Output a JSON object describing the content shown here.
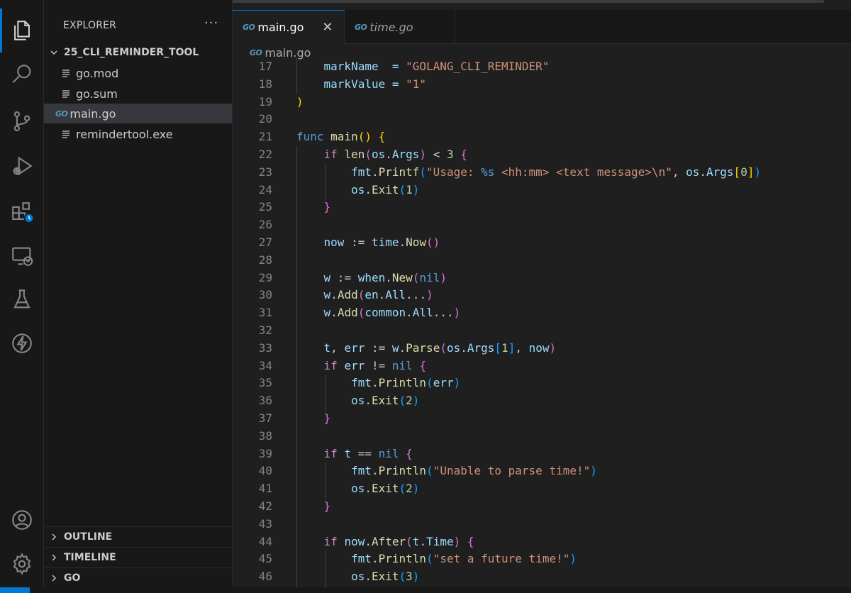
{
  "sidebar": {
    "title": "EXPLORER",
    "more": "···",
    "folder": "25_CLI_REMINDER_TOOL",
    "files": [
      {
        "label": "go.mod",
        "icon": "text-file-icon"
      },
      {
        "label": "go.sum",
        "icon": "text-file-icon"
      },
      {
        "label": "main.go",
        "icon": "go-file-icon",
        "badge": "GO",
        "selected": true
      },
      {
        "label": "remindertool.exe",
        "icon": "text-file-icon"
      }
    ],
    "sections": [
      "OUTLINE",
      "TIMELINE",
      "GO"
    ]
  },
  "tabs": [
    {
      "badge": "GO",
      "label": "main.go",
      "close": "✕"
    },
    {
      "badge": "GO",
      "label": "time.go"
    }
  ],
  "breadcrumb": {
    "badge": "GO",
    "label": "main.go"
  },
  "colors": {
    "accent": "#0078d4",
    "background": "#1f1f1f",
    "sidebar": "#181818",
    "go": "#519aba"
  },
  "code": [
    {
      "n": "17",
      "tokens": [
        [
          "    markName  = ",
          "t-var"
        ],
        [
          "\"GOLANG_CLI_REMINDER\"",
          "t-str"
        ]
      ]
    },
    {
      "n": "18",
      "tokens": [
        [
          "    markValue = ",
          "t-var"
        ],
        [
          "\"1\"",
          "t-str"
        ]
      ]
    },
    {
      "n": "19",
      "tokens": [
        [
          ")",
          "t-b1"
        ]
      ]
    },
    {
      "n": "20",
      "tokens": []
    },
    {
      "n": "21",
      "tokens": [
        [
          "func ",
          "t-kw"
        ],
        [
          "main",
          "t-fn"
        ],
        [
          "()",
          "t-b1"
        ],
        [
          " ",
          "t-plain"
        ],
        [
          "{",
          "t-b1"
        ]
      ]
    },
    {
      "n": "22",
      "tokens": [
        [
          "    ",
          "t-plain"
        ],
        [
          "if ",
          "t-ctl"
        ],
        [
          "len",
          "t-fn"
        ],
        [
          "(",
          "t-b2"
        ],
        [
          "os",
          "t-var"
        ],
        [
          ".",
          "t-plain"
        ],
        [
          "Args",
          "t-var"
        ],
        [
          ")",
          "t-b2"
        ],
        [
          " < ",
          "t-plain"
        ],
        [
          "3",
          "t-num"
        ],
        [
          " ",
          "t-plain"
        ],
        [
          "{",
          "t-b2"
        ]
      ]
    },
    {
      "n": "23",
      "tokens": [
        [
          "        ",
          "t-plain"
        ],
        [
          "fmt",
          "t-var"
        ],
        [
          ".",
          "t-plain"
        ],
        [
          "Printf",
          "t-fn"
        ],
        [
          "(",
          "t-b3"
        ],
        [
          "\"Usage: ",
          "t-str"
        ],
        [
          "%s",
          "t-kw"
        ],
        [
          " <hh:mm> <text message>",
          "t-str"
        ],
        [
          "\\n",
          "t-str"
        ],
        [
          "\"",
          "t-str"
        ],
        [
          ", ",
          "t-plain"
        ],
        [
          "os",
          "t-var"
        ],
        [
          ".",
          "t-plain"
        ],
        [
          "Args",
          "t-var"
        ],
        [
          "[",
          "t-b1"
        ],
        [
          "0",
          "t-num"
        ],
        [
          "]",
          "t-b1"
        ],
        [
          ")",
          "t-b3"
        ]
      ]
    },
    {
      "n": "24",
      "tokens": [
        [
          "        ",
          "t-plain"
        ],
        [
          "os",
          "t-var"
        ],
        [
          ".",
          "t-plain"
        ],
        [
          "Exit",
          "t-fn"
        ],
        [
          "(",
          "t-b3"
        ],
        [
          "1",
          "t-num"
        ],
        [
          ")",
          "t-b3"
        ]
      ]
    },
    {
      "n": "25",
      "tokens": [
        [
          "    ",
          "t-plain"
        ],
        [
          "}",
          "t-b2"
        ]
      ]
    },
    {
      "n": "26",
      "tokens": []
    },
    {
      "n": "27",
      "tokens": [
        [
          "    ",
          "t-plain"
        ],
        [
          "now",
          "t-var"
        ],
        [
          " := ",
          "t-plain"
        ],
        [
          "time",
          "t-var"
        ],
        [
          ".",
          "t-plain"
        ],
        [
          "Now",
          "t-fn"
        ],
        [
          "()",
          "t-b2"
        ]
      ]
    },
    {
      "n": "28",
      "tokens": []
    },
    {
      "n": "29",
      "tokens": [
        [
          "    ",
          "t-plain"
        ],
        [
          "w",
          "t-var"
        ],
        [
          " := ",
          "t-plain"
        ],
        [
          "when",
          "t-var"
        ],
        [
          ".",
          "t-plain"
        ],
        [
          "New",
          "t-fn"
        ],
        [
          "(",
          "t-b2"
        ],
        [
          "nil",
          "t-kw"
        ],
        [
          ")",
          "t-b2"
        ]
      ]
    },
    {
      "n": "30",
      "tokens": [
        [
          "    ",
          "t-plain"
        ],
        [
          "w",
          "t-var"
        ],
        [
          ".",
          "t-plain"
        ],
        [
          "Add",
          "t-fn"
        ],
        [
          "(",
          "t-b2"
        ],
        [
          "en",
          "t-var"
        ],
        [
          ".",
          "t-plain"
        ],
        [
          "All",
          "t-var"
        ],
        [
          "...",
          "t-plain"
        ],
        [
          ")",
          "t-b2"
        ]
      ]
    },
    {
      "n": "31",
      "tokens": [
        [
          "    ",
          "t-plain"
        ],
        [
          "w",
          "t-var"
        ],
        [
          ".",
          "t-plain"
        ],
        [
          "Add",
          "t-fn"
        ],
        [
          "(",
          "t-b2"
        ],
        [
          "common",
          "t-var"
        ],
        [
          ".",
          "t-plain"
        ],
        [
          "All",
          "t-var"
        ],
        [
          "...",
          "t-plain"
        ],
        [
          ")",
          "t-b2"
        ]
      ]
    },
    {
      "n": "32",
      "tokens": []
    },
    {
      "n": "33",
      "tokens": [
        [
          "    ",
          "t-plain"
        ],
        [
          "t",
          "t-var"
        ],
        [
          ", ",
          "t-plain"
        ],
        [
          "err",
          "t-var"
        ],
        [
          " := ",
          "t-plain"
        ],
        [
          "w",
          "t-var"
        ],
        [
          ".",
          "t-plain"
        ],
        [
          "Parse",
          "t-fn"
        ],
        [
          "(",
          "t-b2"
        ],
        [
          "os",
          "t-var"
        ],
        [
          ".",
          "t-plain"
        ],
        [
          "Args",
          "t-var"
        ],
        [
          "[",
          "t-b3"
        ],
        [
          "1",
          "t-num"
        ],
        [
          "]",
          "t-b3"
        ],
        [
          ", ",
          "t-plain"
        ],
        [
          "now",
          "t-var"
        ],
        [
          ")",
          "t-b2"
        ]
      ]
    },
    {
      "n": "34",
      "tokens": [
        [
          "    ",
          "t-plain"
        ],
        [
          "if ",
          "t-ctl"
        ],
        [
          "err",
          "t-var"
        ],
        [
          " != ",
          "t-plain"
        ],
        [
          "nil",
          "t-kw"
        ],
        [
          " ",
          "t-plain"
        ],
        [
          "{",
          "t-b2"
        ]
      ]
    },
    {
      "n": "35",
      "tokens": [
        [
          "        ",
          "t-plain"
        ],
        [
          "fmt",
          "t-var"
        ],
        [
          ".",
          "t-plain"
        ],
        [
          "Println",
          "t-fn"
        ],
        [
          "(",
          "t-b3"
        ],
        [
          "err",
          "t-var"
        ],
        [
          ")",
          "t-b3"
        ]
      ]
    },
    {
      "n": "36",
      "tokens": [
        [
          "        ",
          "t-plain"
        ],
        [
          "os",
          "t-var"
        ],
        [
          ".",
          "t-plain"
        ],
        [
          "Exit",
          "t-fn"
        ],
        [
          "(",
          "t-b3"
        ],
        [
          "2",
          "t-num"
        ],
        [
          ")",
          "t-b3"
        ]
      ]
    },
    {
      "n": "37",
      "tokens": [
        [
          "    ",
          "t-plain"
        ],
        [
          "}",
          "t-b2"
        ]
      ]
    },
    {
      "n": "38",
      "tokens": []
    },
    {
      "n": "39",
      "tokens": [
        [
          "    ",
          "t-plain"
        ],
        [
          "if ",
          "t-ctl"
        ],
        [
          "t",
          "t-var"
        ],
        [
          " == ",
          "t-plain"
        ],
        [
          "nil",
          "t-kw"
        ],
        [
          " ",
          "t-plain"
        ],
        [
          "{",
          "t-b2"
        ]
      ]
    },
    {
      "n": "40",
      "tokens": [
        [
          "        ",
          "t-plain"
        ],
        [
          "fmt",
          "t-var"
        ],
        [
          ".",
          "t-plain"
        ],
        [
          "Println",
          "t-fn"
        ],
        [
          "(",
          "t-b3"
        ],
        [
          "\"Unable to parse time!\"",
          "t-str"
        ],
        [
          ")",
          "t-b3"
        ]
      ]
    },
    {
      "n": "41",
      "tokens": [
        [
          "        ",
          "t-plain"
        ],
        [
          "os",
          "t-var"
        ],
        [
          ".",
          "t-plain"
        ],
        [
          "Exit",
          "t-fn"
        ],
        [
          "(",
          "t-b3"
        ],
        [
          "2",
          "t-num"
        ],
        [
          ")",
          "t-b3"
        ]
      ]
    },
    {
      "n": "42",
      "tokens": [
        [
          "    ",
          "t-plain"
        ],
        [
          "}",
          "t-b2"
        ]
      ]
    },
    {
      "n": "43",
      "tokens": []
    },
    {
      "n": "44",
      "tokens": [
        [
          "    ",
          "t-plain"
        ],
        [
          "if ",
          "t-ctl"
        ],
        [
          "now",
          "t-var"
        ],
        [
          ".",
          "t-plain"
        ],
        [
          "After",
          "t-fn"
        ],
        [
          "(",
          "t-b2"
        ],
        [
          "t",
          "t-var"
        ],
        [
          ".",
          "t-plain"
        ],
        [
          "Time",
          "t-var"
        ],
        [
          ")",
          "t-b2"
        ],
        [
          " ",
          "t-plain"
        ],
        [
          "{",
          "t-b2"
        ]
      ]
    },
    {
      "n": "45",
      "tokens": [
        [
          "        ",
          "t-plain"
        ],
        [
          "fmt",
          "t-var"
        ],
        [
          ".",
          "t-plain"
        ],
        [
          "Println",
          "t-fn"
        ],
        [
          "(",
          "t-b3"
        ],
        [
          "\"set a future time!\"",
          "t-str"
        ],
        [
          ")",
          "t-b3"
        ]
      ]
    },
    {
      "n": "46",
      "tokens": [
        [
          "        ",
          "t-plain"
        ],
        [
          "os",
          "t-var"
        ],
        [
          ".",
          "t-plain"
        ],
        [
          "Exit",
          "t-fn"
        ],
        [
          "(",
          "t-b3"
        ],
        [
          "3",
          "t-num"
        ],
        [
          ")",
          "t-b3"
        ]
      ]
    }
  ]
}
